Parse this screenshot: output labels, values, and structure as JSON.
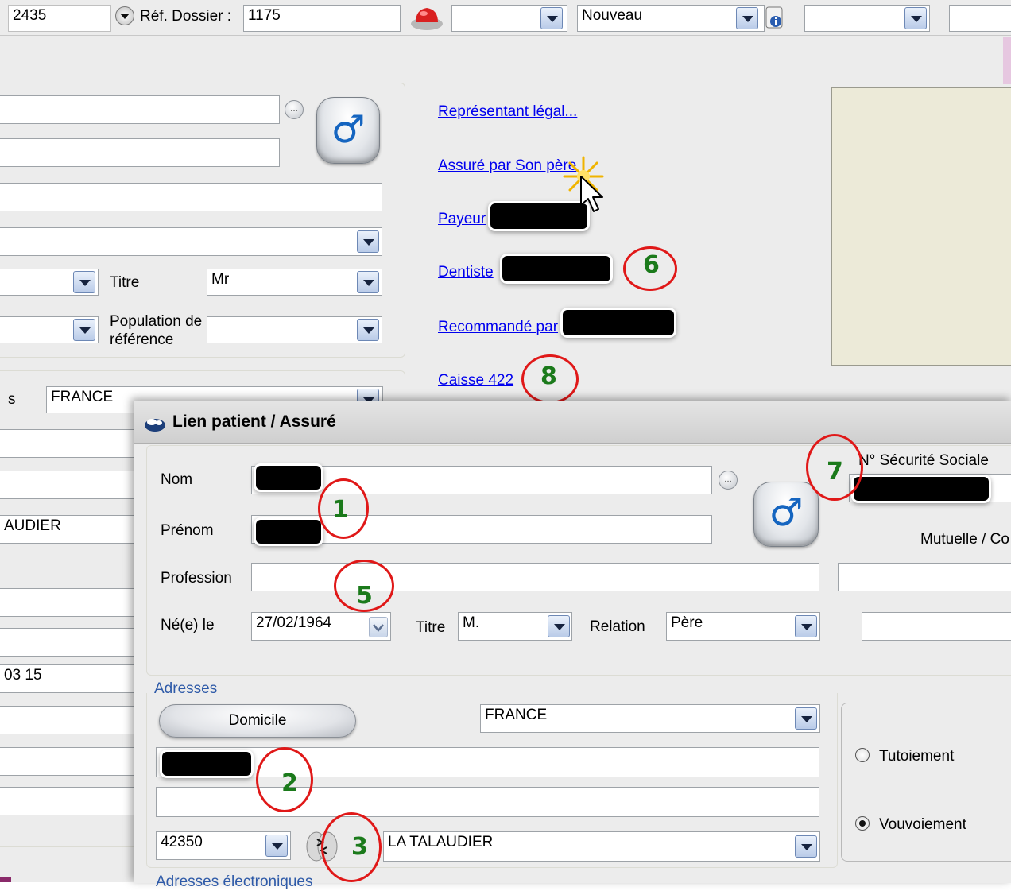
{
  "toolbar": {
    "id_value": "2435",
    "ref_label": "Réf. Dossier :",
    "ref_value": "1175",
    "status_value": "Nouveau"
  },
  "main": {
    "titre_label": "Titre",
    "titre_value": "Mr",
    "population_label_1": "Population de",
    "population_label_2": "référence",
    "pays_label": "s",
    "pays_value": "FRANCE",
    "ville_fragment": "AUDIER",
    "phone_fragment": "03 15"
  },
  "links": {
    "representant": "Représentant légal...",
    "assure": "Assuré par Son père",
    "payeur": "Payeur",
    "dentiste": "Dentiste",
    "recommande": "Recommandé par",
    "caisse": "Caisse 422"
  },
  "dialog": {
    "title": "Lien patient / Assuré",
    "nom_label": "Nom",
    "prenom_label": "Prénom",
    "profession_label": "Profession",
    "ne_label": "Né(e) le",
    "ne_value": "27/02/1964",
    "titre_label": "Titre",
    "titre_value": "M.",
    "relation_label": "Relation",
    "relation_value": "Père",
    "secu_label": "N° Sécurité Sociale",
    "mutuelle_label": "Mutuelle / Co",
    "adresses_label": "Adresses",
    "domicile_button": "Domicile",
    "pays_value": "FRANCE",
    "cp_value": "42350",
    "ville_value": "LA TALAUDIER",
    "tutoiement": "Tutoiement",
    "vouvoiement": "Vouvoiement",
    "adresses_electroniques": "Adresses électroniques"
  },
  "annotations": [
    "1",
    "2",
    "3",
    "5",
    "6",
    "7",
    "8"
  ],
  "icons": [
    "arrow-down-circle-icon",
    "alarm-icon",
    "document-info-icon",
    "male-symbol-icon",
    "dialog-app-icon",
    "swap-arrows-icon",
    "cursor-icon",
    "sparkle-icon"
  ]
}
